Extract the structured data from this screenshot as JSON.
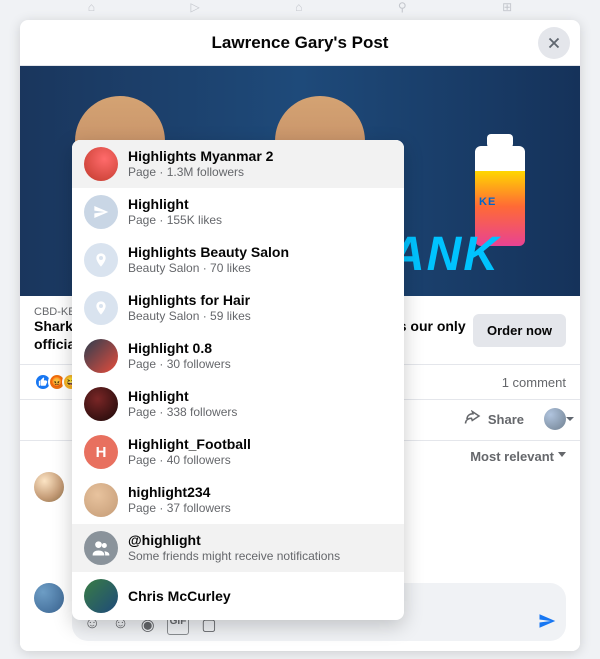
{
  "header": {
    "title": "Lawrence Gary's Post"
  },
  "post": {
    "image_text": "ANK",
    "bottle_label": "KE",
    "link_domain": "CBD-KE",
    "headline_prefix": "Shark",
    "headline_mid": "his is our only",
    "headline_suffix": "officia",
    "cta_label": "Order now",
    "comment_count": "1 comment",
    "share_label": "Share",
    "sort_label": "Most relevant"
  },
  "compose": {
    "text": "@highlight"
  },
  "mentions": [
    {
      "name": "Highlights Myanmar 2",
      "meta": "Page · 1.3M followers",
      "avatar": "red",
      "selected": true
    },
    {
      "name": "Highlight",
      "meta": "Page · 155K likes",
      "avatar": "blue"
    },
    {
      "name": "Highlights Beauty Salon",
      "meta": "Beauty Salon · 70 likes",
      "avatar": "pin"
    },
    {
      "name": "Highlights for Hair",
      "meta": "Beauty Salon · 59 likes",
      "avatar": "pin"
    },
    {
      "name": "Highlight 0.8",
      "meta": "Page · 30 followers",
      "avatar": "helmet"
    },
    {
      "name": "Highlight",
      "meta": "Page · 338 followers",
      "avatar": "darkred"
    },
    {
      "name": "Highlight_Football",
      "meta": "Page · 40 followers",
      "avatar": "letter",
      "letter": "H"
    },
    {
      "name": "highlight234",
      "meta": "Page · 37 followers",
      "avatar": "hand"
    },
    {
      "name": "@highlight",
      "meta": "Some friends might receive notifications",
      "avatar": "grey",
      "selected": true
    },
    {
      "name": "Chris McCurley",
      "meta": "",
      "avatar": "photo"
    }
  ]
}
